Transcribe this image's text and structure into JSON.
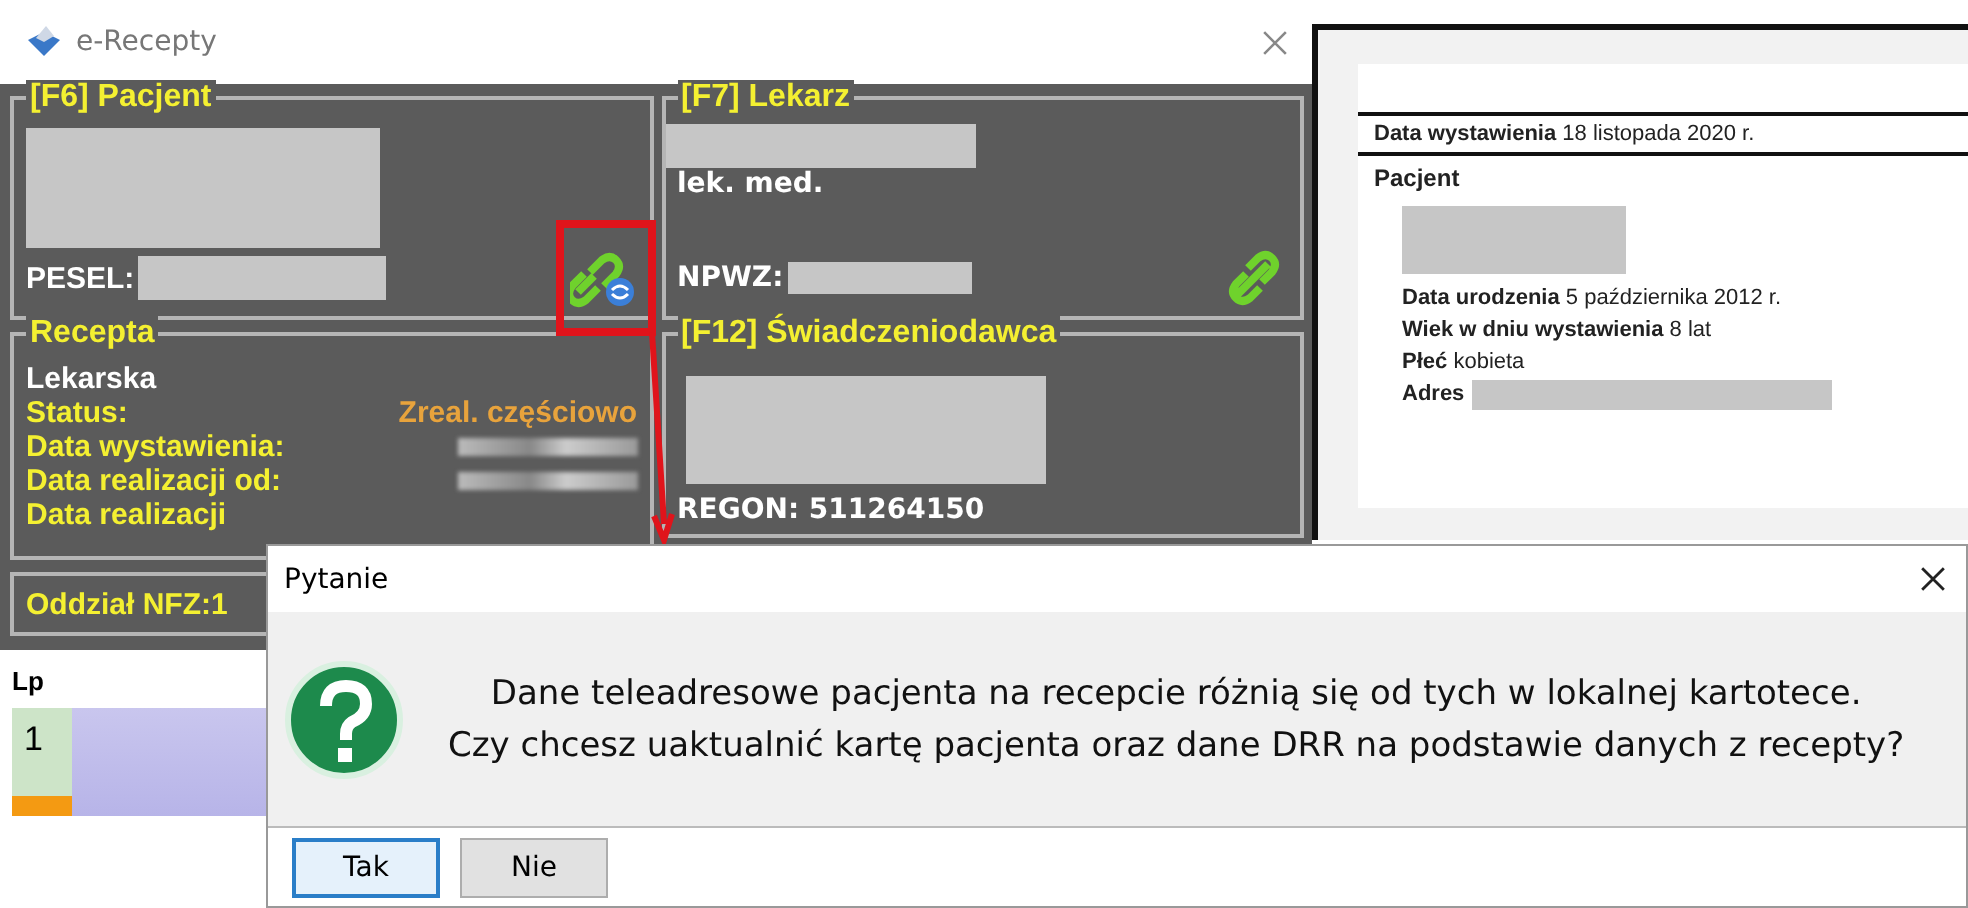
{
  "main_window": {
    "title": "e-Recepty"
  },
  "patient_panel": {
    "title": "[F6] Pacjent",
    "pesel_label": "PESEL:"
  },
  "doctor_panel": {
    "title": "[F7] Lekarz",
    "degree": "lek. med.",
    "npwz_label": "NPWZ:"
  },
  "prescription_panel": {
    "title": "Recepta",
    "type": "Lekarska",
    "status_label": "Status:",
    "status_value": "Zreal. częściowo",
    "rows": [
      {
        "label": "Data wystawienia:",
        "blurred": true
      },
      {
        "label": "Data realizacji od:",
        "blurred": true
      },
      {
        "label": "Data realizacji",
        "blurred": false
      }
    ]
  },
  "provider_panel": {
    "title": "[F12] Świadczeniodawca",
    "regon": "REGON: 511264150"
  },
  "nfz": {
    "label": "Oddział NFZ:1"
  },
  "list": {
    "header": "Lp",
    "rows": [
      {
        "lp": "1"
      }
    ]
  },
  "preview": {
    "issue_label": "Data wystawienia",
    "issue_value": "18 listopada 2020 r.",
    "section": "Pacjent",
    "fields": [
      {
        "label": "Data urodzenia",
        "value": "5 października 2012 r."
      },
      {
        "label": "Wiek w dniu wystawienia",
        "value": "8 lat"
      },
      {
        "label": "Płeć",
        "value": "kobieta"
      },
      {
        "label": "Adres"
      }
    ]
  },
  "dialog": {
    "title": "Pytanie",
    "message": [
      "Dane teleadresowe pacjenta na recepcie różnią się od tych w lokalnej kartotece.",
      "Czy chcesz uaktualnić kartę pacjenta oraz dane DRR na podstawie danych z recepty?"
    ],
    "buttons": [
      {
        "label": "Tak",
        "selected": true
      },
      {
        "label": "Nie",
        "selected": false
      }
    ]
  }
}
